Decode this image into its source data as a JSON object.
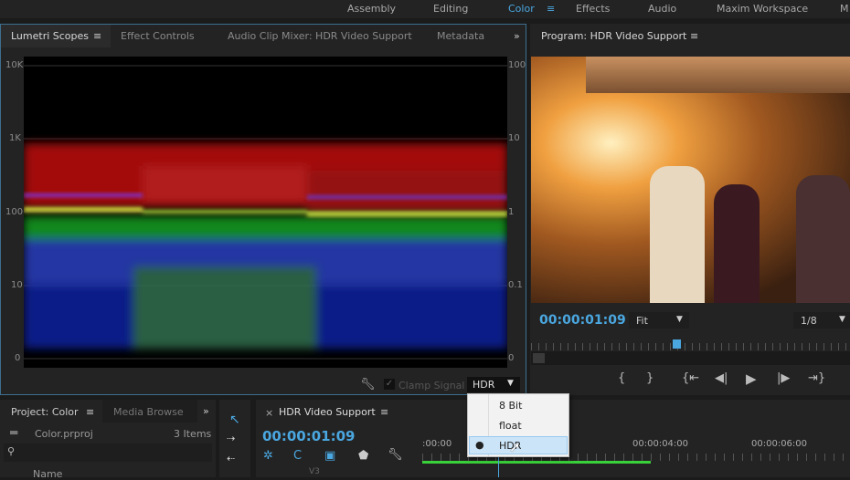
{
  "workspaces": [
    "Assembly",
    "Editing",
    "Color",
    "Effects",
    "Audio",
    "Maxim Workspace",
    "M"
  ],
  "active_workspace": "Color",
  "left_panel": {
    "tabs": [
      "Lumetri Scopes",
      "Effect Controls",
      "Audio Clip Mixer: HDR Video Support",
      "Metadata"
    ],
    "overflow": "»"
  },
  "scope": {
    "left_axis": [
      "10K",
      "1K",
      "100",
      "10",
      "0"
    ],
    "right_axis": [
      "100",
      "10",
      "1",
      "0.1",
      "0"
    ],
    "clamp_label": "Clamp Signal",
    "clamp_checked": true,
    "mode_value": "HDR",
    "mode_options": [
      "8 Bit",
      "float",
      "HDR"
    ],
    "selected_option": "HDR"
  },
  "program": {
    "title": "Program: HDR Video Support",
    "timecode": "00:00:01:09",
    "zoom": "Fit",
    "resolution": "1/8"
  },
  "project": {
    "title": "Project: Color",
    "tab2": "Media Browse",
    "file": "Color.prproj",
    "count": "3 Items",
    "col_name": "Name"
  },
  "timeline": {
    "title": "HDR Video Support",
    "timecode": "00:00:01:09",
    "ticks": [
      ":00:00",
      "00:00:04:00",
      "00:00:06:00"
    ],
    "track": "V3"
  },
  "colors": {
    "accent": "#4aa7e0",
    "panel": "#232323"
  }
}
